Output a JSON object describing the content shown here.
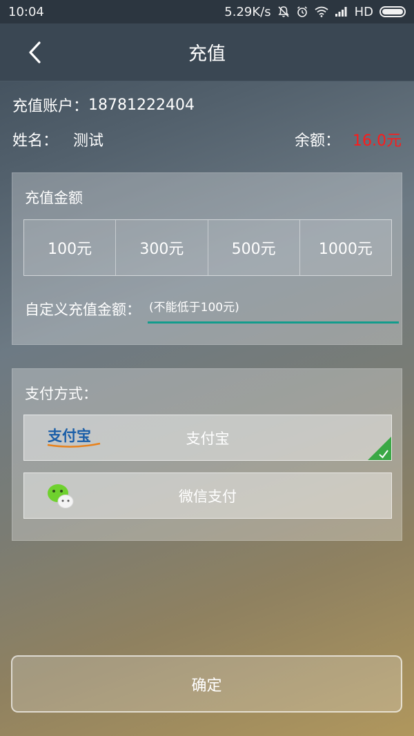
{
  "status_bar": {
    "time": "10:04",
    "network_speed": "5.29K/s",
    "network_type": "HD",
    "icons": [
      "mute-icon",
      "alarm-icon",
      "wifi-icon",
      "signal-icon",
      "battery-icon"
    ]
  },
  "app_bar": {
    "title": "充值",
    "back_icon": "chevron-left-icon"
  },
  "account": {
    "account_label": "充值账户：",
    "account_number": "18781222404",
    "name_label": "姓名：",
    "name_value": "测试",
    "balance_label": "余额：",
    "balance_value": "16.0元",
    "balance_color": "#ff1a1a"
  },
  "amount_section": {
    "title": "充值金额",
    "options": [
      "100元",
      "300元",
      "500元",
      "1000元"
    ],
    "custom_label": "自定义充值金额：",
    "custom_placeholder": "(不能低于100元)",
    "input_accent": "#129c8c"
  },
  "payment_section": {
    "title": "支付方式：",
    "methods": [
      {
        "label": "支付宝",
        "logo_text": "支付宝",
        "icon": "alipay-logo",
        "selected": true
      },
      {
        "label": "微信支付",
        "icon": "wechat-icon",
        "selected": false
      }
    ],
    "check_color": "#3aa845"
  },
  "confirm": {
    "label": "确定"
  }
}
